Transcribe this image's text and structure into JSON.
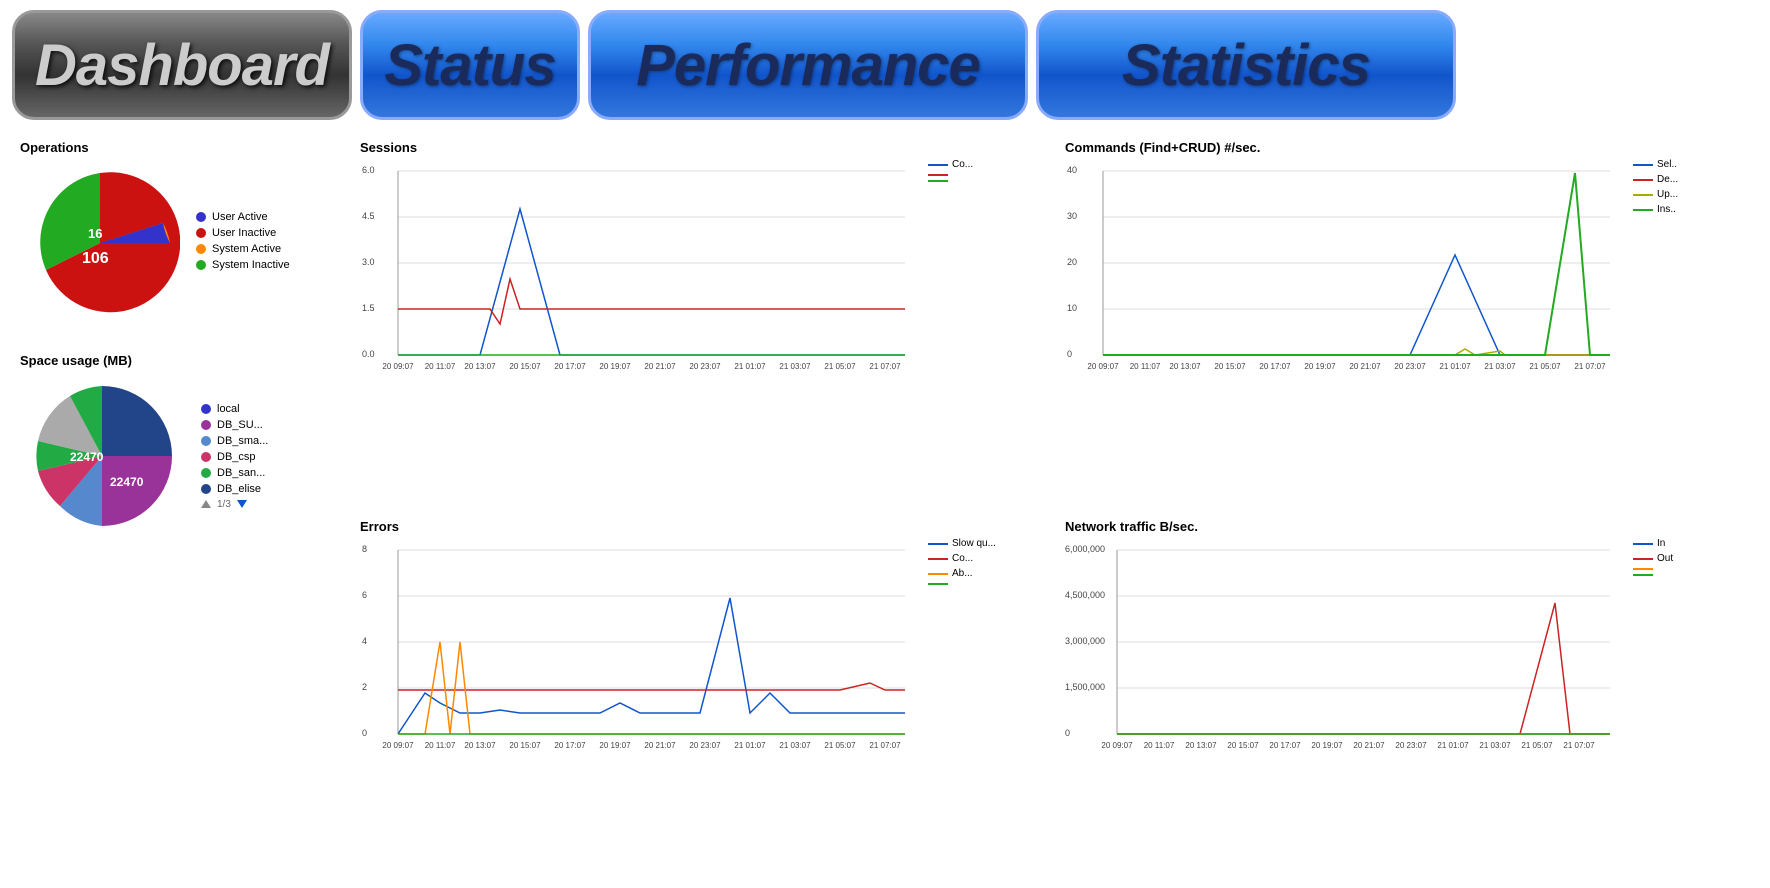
{
  "header": {
    "dashboard_label": "Dashboard",
    "status_label": "Status",
    "performance_label": "Performance",
    "statistics_label": "Statistics"
  },
  "operations": {
    "title": "Operations",
    "legend": [
      {
        "label": "User Active",
        "color": "#3333cc"
      },
      {
        "label": "User Inactive",
        "color": "#cc1111"
      },
      {
        "label": "System Active",
        "color": "#ff8800"
      },
      {
        "label": "System Inactive",
        "color": "#22aa22"
      }
    ],
    "slices": [
      {
        "value": 16,
        "color": "#22aa22",
        "startAngle": 0,
        "endAngle": 43
      },
      {
        "value": 106,
        "color": "#cc1111",
        "startAngle": 43,
        "endAngle": 330
      },
      {
        "value": 2,
        "color": "#ff8800",
        "startAngle": 330,
        "endAngle": 340
      },
      {
        "value": 3,
        "color": "#3333cc",
        "startAngle": 340,
        "endAngle": 360
      }
    ],
    "label_16": "16",
    "label_106": "106"
  },
  "space_usage": {
    "title": "Space usage (MB)",
    "legend": [
      {
        "label": "local",
        "color": "#3333cc"
      },
      {
        "label": "DB_SU...",
        "color": "#993399"
      },
      {
        "label": "DB_sma...",
        "color": "#5588cc"
      },
      {
        "label": "DB_csp",
        "color": "#cc3366"
      },
      {
        "label": "DB_san...",
        "color": "#22aa44"
      },
      {
        "label": "DB_elise",
        "color": "#224488"
      }
    ],
    "label_22470a": "22470",
    "label_22470b": "22470",
    "pagination": "1/3"
  },
  "sessions_chart": {
    "title": "Sessions",
    "legend": [
      {
        "label": "Co...",
        "color": "#1155cc"
      },
      {
        "label": "",
        "color": "#cc2222"
      },
      {
        "label": "",
        "color": "#22aa22"
      }
    ],
    "y_labels": [
      "6.0",
      "4.5",
      "3.0",
      "1.5",
      "0.0"
    ],
    "x_labels": [
      "20 09:07",
      "20 11:07",
      "20 13:07",
      "20 15:07",
      "20 17:07",
      "20 19:07",
      "20 21:07",
      "20 23:07",
      "21 01:07",
      "21 03:07",
      "21 05:07",
      "21 07:07"
    ]
  },
  "commands_chart": {
    "title": "Commands (Find+CRUD) #/sec.",
    "legend": [
      {
        "label": "Sel..",
        "color": "#1155cc"
      },
      {
        "label": "De...",
        "color": "#cc2222"
      },
      {
        "label": "Up...",
        "color": "#aaaa00"
      },
      {
        "label": "Ins..",
        "color": "#22aa22"
      }
    ],
    "y_labels": [
      "40",
      "30",
      "20",
      "10",
      "0"
    ],
    "x_labels": [
      "20 09:07",
      "20 11:07",
      "20 13:07",
      "20 15:07",
      "20 17:07",
      "20 19:07",
      "20 21:07",
      "20 23:07",
      "21 01:07",
      "21 03:07",
      "21 05:07",
      "21 07:07"
    ]
  },
  "errors_chart": {
    "title": "Errors",
    "legend": [
      {
        "label": "Slow qu...",
        "color": "#1155cc"
      },
      {
        "label": "Co...",
        "color": "#cc2222"
      },
      {
        "label": "Ab...",
        "color": "#ff8800"
      },
      {
        "label": "",
        "color": "#22aa22"
      }
    ],
    "y_labels": [
      "8",
      "6",
      "4",
      "2",
      "0"
    ],
    "x_labels": [
      "20 09:07",
      "20 11:07",
      "20 13:07",
      "20 15:07",
      "20 17:07",
      "20 19:07",
      "20 21:07",
      "20 23:07",
      "21 01:07",
      "21 03:07",
      "21 05:07",
      "21 07:07"
    ]
  },
  "network_chart": {
    "title": "Network traffic B/sec.",
    "legend": [
      {
        "label": "In",
        "color": "#1155cc"
      },
      {
        "label": "Out",
        "color": "#cc2222"
      },
      {
        "label": "",
        "color": "#ff8800"
      },
      {
        "label": "",
        "color": "#22aa22"
      }
    ],
    "y_labels": [
      "6,000,000",
      "4,500,000",
      "3,000,000",
      "1,500,000",
      "0"
    ],
    "x_labels": [
      "20 09:07",
      "20 11:07",
      "20 13:07",
      "20 15:07",
      "20 17:07",
      "20 19:07",
      "20 21:07",
      "20 23:07",
      "21 01:07",
      "21 03:07",
      "21 05:07",
      "21 07:07"
    ]
  }
}
